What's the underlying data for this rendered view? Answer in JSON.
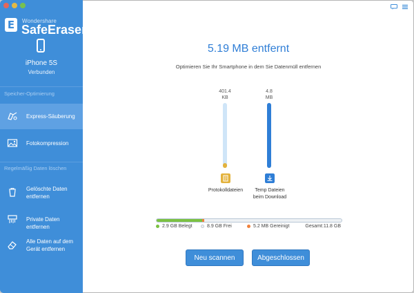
{
  "brand": {
    "company": "Wondershare",
    "product": "SafeEraser"
  },
  "device": {
    "name": "iPhone 5S",
    "status": "Verbunden"
  },
  "sidebar": {
    "sections": [
      "Speicher-Optimierung",
      "Regelmäßig Daten löschen"
    ],
    "items": [
      {
        "label": "Express-Säuberung",
        "icon": "express-clean-icon"
      },
      {
        "label": "Fotokompression",
        "icon": "photo-icon"
      },
      {
        "label": "Gelöschte Daten\nentfernen",
        "icon": "trash-icon"
      },
      {
        "label": "Private Daten entfernen",
        "icon": "shredder-icon"
      },
      {
        "label": "Alle Daten auf dem\nGerät entfernen",
        "icon": "eraser-icon"
      }
    ]
  },
  "main": {
    "title": "5.19 MB entfernt",
    "subtitle": "Optimieren Sie Ihr Smartphone in dem Sie Datenmüll entfernen",
    "categories": [
      {
        "value": "401.4\nKB",
        "label": "Protokolldateien",
        "fill_fraction": 0.07,
        "color": "#e3b23c",
        "icon": "log-file-icon"
      },
      {
        "value": "4.8\nMB",
        "label": "Temp Dateien\nbeim Download",
        "fill_fraction": 1.0,
        "color": "#2f7ed6",
        "icon": "download-icon"
      }
    ]
  },
  "storage": {
    "used_label": "2.9 GB Belegt",
    "free_label": "8.9 GB Frei",
    "freed_label": "5.2 MB Gereinigt",
    "total_label": "Gesamt:11.8 GB",
    "used_fraction": 0.246,
    "freed_fraction": 0.005,
    "colors": {
      "used": "#7bc142",
      "free": "#eef1f4",
      "freed": "#f0813b"
    }
  },
  "buttons": {
    "rescan": "Neu scannen",
    "done": "Abgeschlossen"
  }
}
